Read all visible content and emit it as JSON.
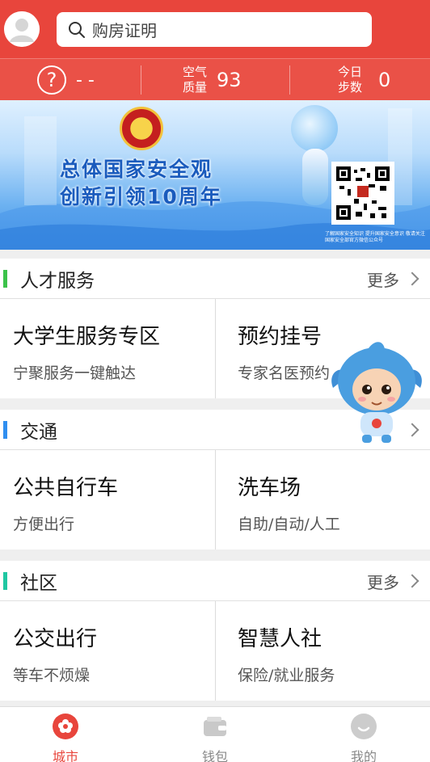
{
  "header": {
    "search_placeholder": "购房证明"
  },
  "status": {
    "help_value": "- -",
    "air_label_line1": "空气",
    "air_label_line2": "质量",
    "air_value": "93",
    "steps_label_line1": "今日",
    "steps_label_line2": "步数",
    "steps_value": "0"
  },
  "banner": {
    "title_line1": "总体国家安全观",
    "title_line2": "创新引领10周年",
    "qr_caption": "了解国家安全知识 提升国家安全意识 敬请关注国家安全部官方微信公众号"
  },
  "sections": [
    {
      "title": "人才服务",
      "more": "更多",
      "accent": "#3bc24a",
      "cards": [
        {
          "title": "大学生服务专区",
          "sub": "宁聚服务一键触达"
        },
        {
          "title": "预约挂号",
          "sub": "专家名医预约"
        }
      ]
    },
    {
      "title": "交通",
      "more": "",
      "accent": "#2f8ef0",
      "cards": [
        {
          "title": "公共自行车",
          "sub": "方便出行"
        },
        {
          "title": "洗车场",
          "sub": "自助/自动/人工"
        }
      ]
    },
    {
      "title": "社区",
      "more": "更多",
      "accent": "#1fc7a2",
      "cards": [
        {
          "title": "公交出行",
          "sub": "等车不烦燥"
        },
        {
          "title": "智慧人社",
          "sub": "保险/就业服务"
        }
      ]
    }
  ],
  "nav": [
    {
      "label": "城市",
      "icon": "city-flower-icon",
      "active": true
    },
    {
      "label": "钱包",
      "icon": "wallet-icon",
      "active": false
    },
    {
      "label": "我的",
      "icon": "profile-smile-icon",
      "active": false
    }
  ],
  "colors": {
    "brand_red": "#e8453c"
  }
}
